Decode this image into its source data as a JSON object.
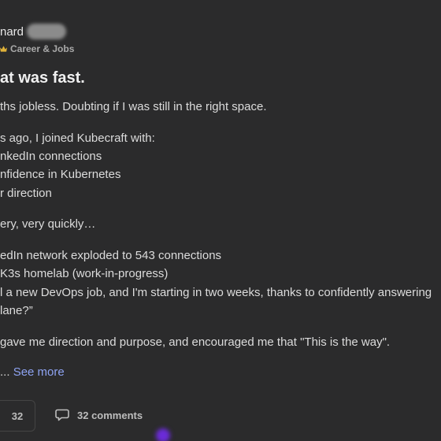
{
  "post": {
    "author_name": "nard",
    "category": "Career & Jobs",
    "title": "at was fast.",
    "lines": [
      "ths jobless. Doubting if I was still in the right space.",
      "s ago, I joined Kubecraft with:",
      "nkedIn connections",
      "nfidence in Kubernetes",
      "r direction",
      "ery, very quickly…",
      "edIn network exploded to 543 connections",
      "K3s homelab (work-in-progress)",
      "l a new DevOps job, and I'm starting in two weeks, thanks to confidently answering",
      "lane?”",
      "gave me direction and purpose, and encouraged me that \"This is the way\"."
    ],
    "ellipsis": "...",
    "see_more": "See more"
  },
  "footer": {
    "reaction_count": "32",
    "comments_label": "32 comments"
  },
  "icons": {
    "category": "crown-icon",
    "comments": "comment-bubble-icon"
  },
  "colors": {
    "background": "#2b2b2c",
    "link": "#8ea3f2",
    "glow": "#6b2bd9"
  }
}
